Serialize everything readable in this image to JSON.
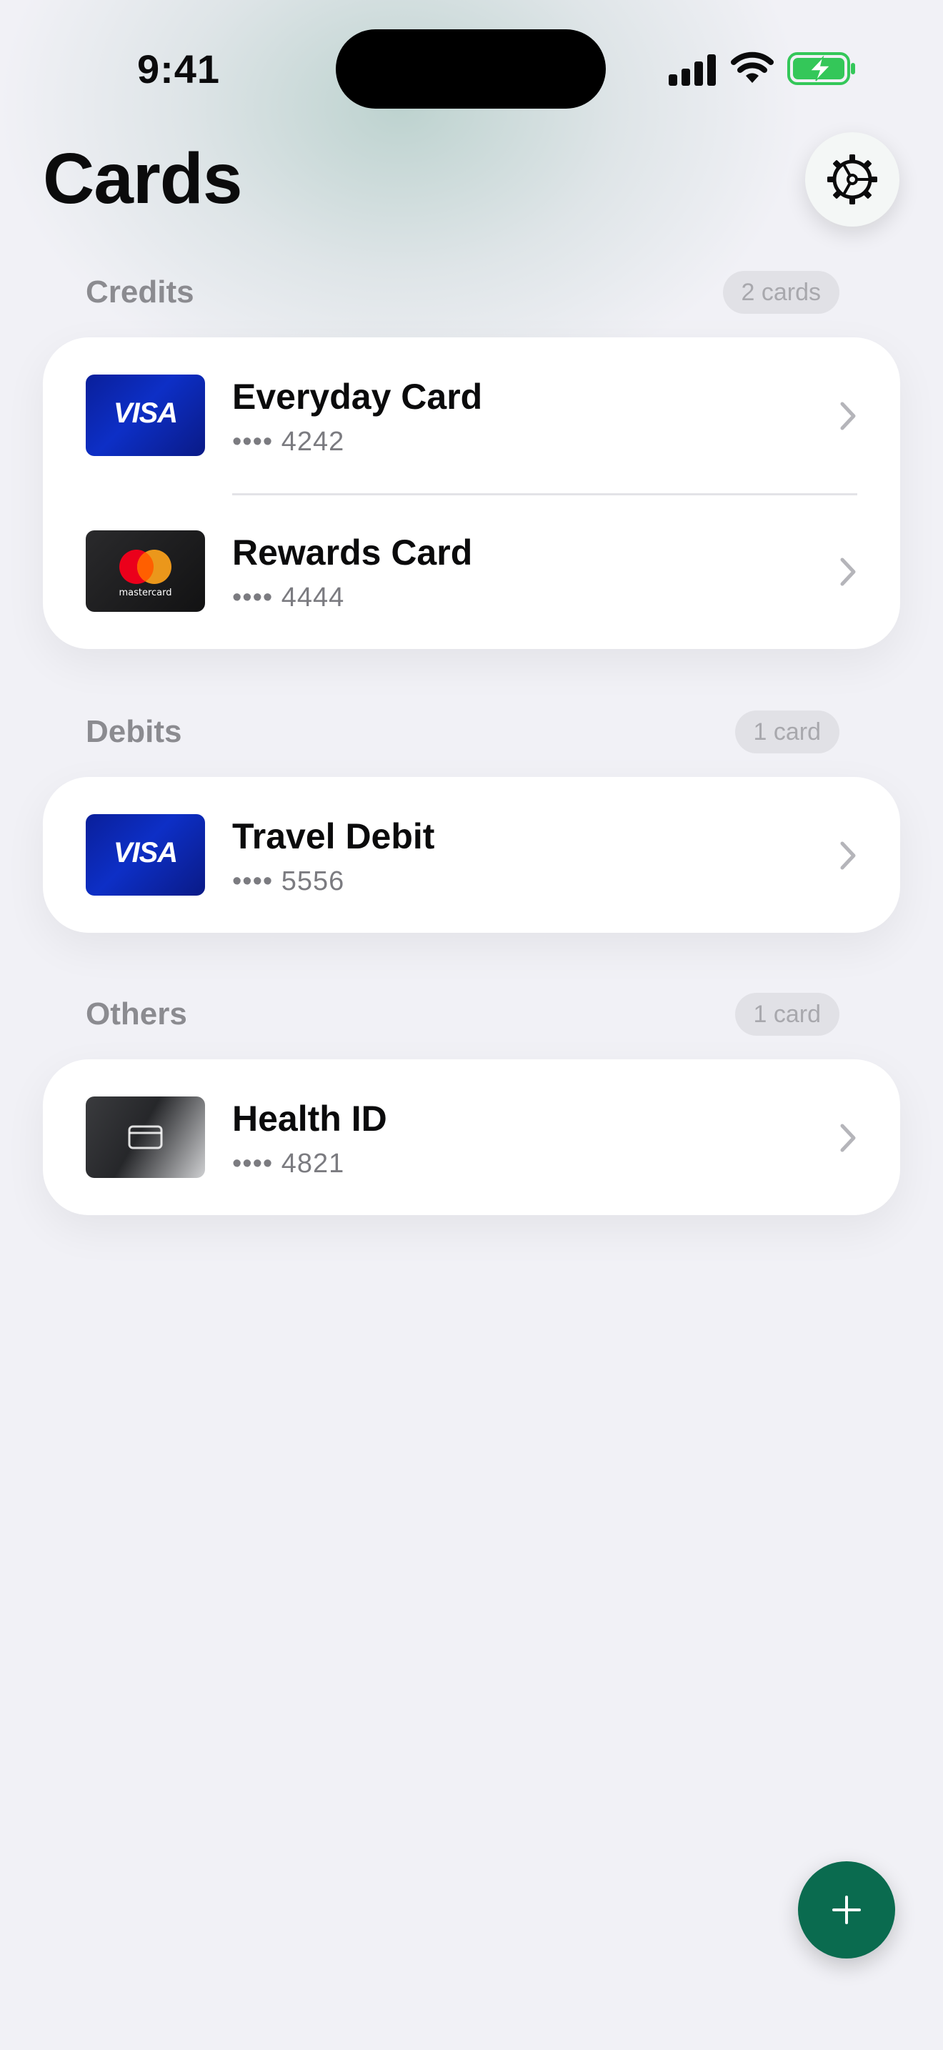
{
  "status_bar": {
    "time": "9:41"
  },
  "header": {
    "title": "Cards"
  },
  "sections": [
    {
      "label": "Credits",
      "count": "2 cards",
      "cards": [
        {
          "name": "Everyday Card",
          "number": "•••• 4242",
          "brand": "VISA"
        },
        {
          "name": "Rewards Card",
          "number": "•••• 4444",
          "brand": "mastercard"
        }
      ]
    },
    {
      "label": "Debits",
      "count": "1 card",
      "cards": [
        {
          "name": "Travel Debit",
          "number": "•••• 5556",
          "brand": "VISA"
        }
      ]
    },
    {
      "label": "Others",
      "count": "1 card",
      "cards": [
        {
          "name": "Health ID",
          "number": "•••• 4821",
          "brand": ""
        }
      ]
    }
  ],
  "colors": {
    "accent": "#0a6b4f",
    "battery": "#34c759",
    "background": "#f1f1f6"
  },
  "icons": {
    "settings": "gear-icon",
    "add": "plus-icon",
    "row_disclosure": "chevron-right-icon"
  }
}
